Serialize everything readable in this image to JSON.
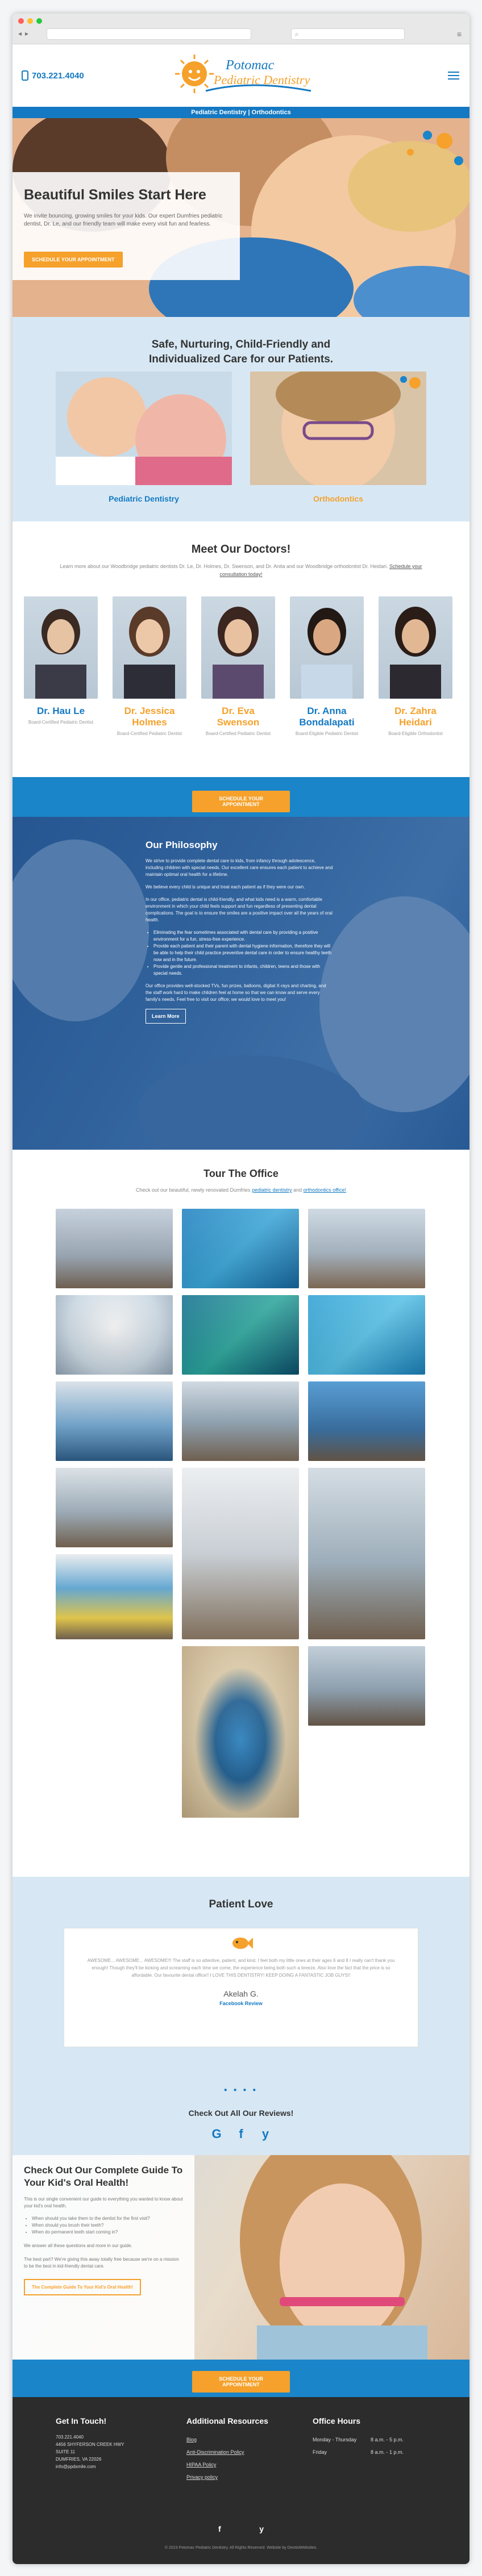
{
  "header": {
    "phone": "703.221.4040",
    "logo_line1": "Potomac",
    "logo_line2": "Pediatric Dentistry",
    "subnav": "Pediatric Dentistry | Orthodontics"
  },
  "hero": {
    "title": "Beautiful Smiles Start Here",
    "subtitle": "We invite bouncing, growing smiles for your kids. Our expert Dumfries pediatric dentist, Dr. Le, and our friendly team will make every visit fun and fearless.",
    "cta": "Schedule Your Appointment"
  },
  "care": {
    "title_line1": "Safe, Nurturing, Child-Friendly and",
    "title_line2": "Individualized Care for our Patients.",
    "left_label": "Pediatric Dentistry",
    "right_label": "Orthodontics"
  },
  "doctors": {
    "title": "Meet Our Doctors!",
    "intro": "Learn more about our Woodbridge pediatric dentists Dr. Le, Dr. Holmes, Dr. Swenson, and Dr. Anita and our Woodbridge orthodontist Dr. Heidari.",
    "intro_link": "Schedule your consultation today!",
    "list": [
      {
        "name": "Dr. Hau Le",
        "role": "Board-Certified Pediatric Dentist"
      },
      {
        "name": "Dr. Jessica Holmes",
        "role": "Board-Certified Pediatric Dentist"
      },
      {
        "name": "Dr. Eva Swenson",
        "role": "Board-Certified Pediatric Dentist"
      },
      {
        "name": "Dr. Anna Bondalapati",
        "role": "Board-Eligible Pediatric Dentist"
      },
      {
        "name": "Dr. Zahra Heidari",
        "role": "Board-Eligible Orthodontist"
      }
    ]
  },
  "cta_band": {
    "label": "Schedule Your Appointment"
  },
  "philosophy": {
    "title": "Our Philosophy",
    "p1": "We strive to provide complete dental care to kids, from infancy through adolescence, including children with special needs. Our excellent care ensures each patient to achieve and maintain optimal oral health for a lifetime.",
    "p2": "We believe every child is unique and treat each patient as if they were our own.",
    "p3": "In our office, pediatric dental is child-friendly, and what kids need is a warm, comfortable environment in which your child feels support and fun regardless of presenting dental complications. The goal is to ensure the smiles are a positive impact over all the years of oral health.",
    "bullets": [
      "Eliminating the fear sometimes associated with dental care by providing a positive environment for a fun, stress-free experience.",
      "Provide each patient and their parent with dental hygiene information, therefore they will be able to help their child practice preventive dental care in order to ensure healthy teeth now and in the future.",
      "Provide gentle and professional treatment to infants, children, teens and those with special needs."
    ],
    "p4": "Our office provides well-stocked TVs, fun prizes, balloons, digital X-rays and charting, and the staff work hard to make children feel at home so that we can know and serve every family's needs. Feel free to visit our office; we would love to meet you!",
    "button": "Learn More"
  },
  "tour": {
    "title": "Tour The Office",
    "sub_prefix": "Check out our beautiful, newly renovated Dumfries",
    "link1": "pediatric dentistry",
    "sub_mid": "and",
    "link2": "orthodontics office!",
    "photos": [
      "Waiting Room",
      "Aquarium Mural",
      "Front Desk",
      "Reception",
      "Sea Turtle Mural",
      "Fish Mural",
      "Kids Lounge",
      "Treatment Bay",
      "Play Area",
      "Hallway",
      "Sink Station",
      "Operatory Row",
      "Art Wall",
      "Sterilization",
      "Entry Arch"
    ]
  },
  "love": {
    "title": "Patient Love",
    "review": "AWESOME... AWESOME... AWESOME!!! The staff is so attentive, patient, and kind. I feel both my little ones at their ages 6 and 8 I really can't thank you enough! Though they'll be kicking and screaming each time we come, the experience being both such a breeze. Also love the fact that the price is so affordable. Our favourite dental office!! I LOVE THIS DENTISTRY! KEEP DOING A FANTASTIC JOB GUYS!!",
    "author": "Akelah G.",
    "source": "Facebook Review",
    "dots": "● ● ● ●",
    "check": "Check Out All Our Reviews!",
    "socials": [
      "G",
      "f",
      "y"
    ]
  },
  "guide": {
    "title": "Check Out Our Complete Guide To Your Kid's Oral Health!",
    "p1": "This is our single convenient our guide to everything you wanted to know about your kid's oral health.",
    "bullets": [
      "When should you take them to the dentist for the first visit?",
      "When should you brush their teeth?",
      "When do permanent teeth start coming in?"
    ],
    "p2": "We answer all these questions and more in our guide.",
    "p3": "The best part? We're giving this away totally free because we're on a mission to be the best in kid-friendly dental care.",
    "button": "The Complete Guide To Your Kid's Oral Health!"
  },
  "cta_band2": {
    "label": "Schedule Your Appointment"
  },
  "footer": {
    "col1_title": "Get In Touch!",
    "col1_lines": [
      "703.221.4040",
      "4456 SHYFERSON CREEK HWY",
      "SUITE 11",
      "DUMFRIES, VA 22026",
      "info@ppdsmile.com"
    ],
    "col2_title": "Additional Resources",
    "col2_links": [
      "Blog",
      "Anti-Discrimination Policy",
      "HIPAA Policy",
      "Privacy policy"
    ],
    "col3_title": "Office Hours",
    "hours": [
      {
        "day": "Monday - Thursday",
        "time": "8 a.m. - 5 p.m."
      },
      {
        "day": "Friday",
        "time": "8 a.m. - 1 p.m."
      }
    ],
    "socials": [
      "f",
      "y"
    ],
    "copyright": "© 2023 Potomac Pediatric Dentistry. All Rights Reserved. Website by DentistWebsites."
  },
  "colors": {
    "brand_blue": "#1479c2",
    "accent_orange": "#f5a12b",
    "light_blue": "#d7e8f4",
    "footer": "#2c2c2c"
  }
}
